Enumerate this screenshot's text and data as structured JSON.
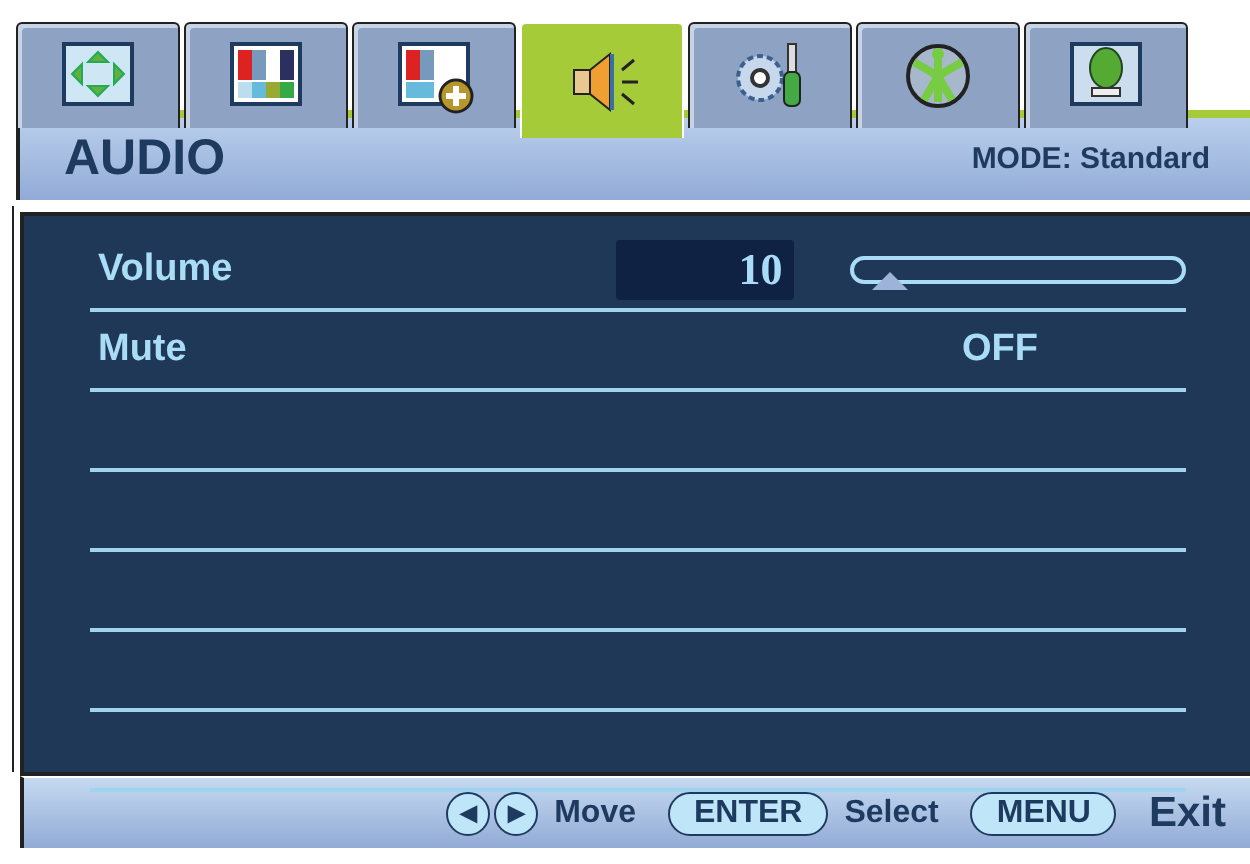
{
  "tabs": [
    {
      "kind": "position",
      "selected": false
    },
    {
      "kind": "picture",
      "selected": false
    },
    {
      "kind": "picture_advanced",
      "selected": false
    },
    {
      "kind": "audio",
      "selected": true
    },
    {
      "kind": "system",
      "selected": false
    },
    {
      "kind": "personalization",
      "selected": false
    },
    {
      "kind": "display",
      "selected": false
    }
  ],
  "header": {
    "title": "AUDIO",
    "mode": "MODE: Standard"
  },
  "items": [
    {
      "kind": "slider",
      "label": "Volume",
      "value": "10",
      "level": 0.08
    },
    {
      "kind": "option",
      "label": "Mute",
      "value": "OFF"
    }
  ],
  "footer": [
    {
      "keys": [
        "◀",
        "▶"
      ],
      "label": "Move"
    },
    {
      "keys": [
        "ENTER"
      ],
      "label": "Select"
    },
    {
      "keys": [
        "MENU"
      ],
      "label": "Exit"
    }
  ]
}
